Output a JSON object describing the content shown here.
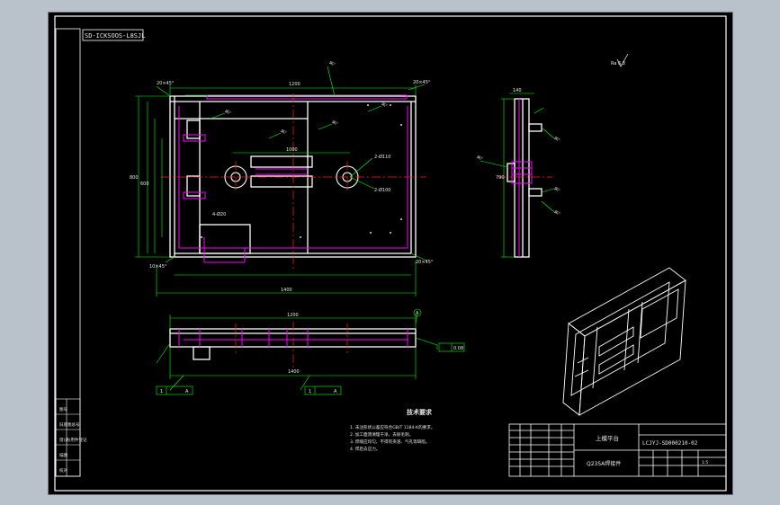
{
  "colors": {
    "background": "#000000",
    "border": "#ffffff",
    "outline": "#ffffff",
    "hidden": "#ff00ff",
    "dimension": "#00ff00",
    "center": "#ff2020",
    "text": "#e8e8e8"
  },
  "frame": {
    "drawing_code_box": "SD-ICKSOOS-L8SJL"
  },
  "views": {
    "front": {
      "dims": {
        "overall_width": "1400",
        "inner_width": "1200",
        "height_left": "800",
        "height_left2": "600",
        "center_mid": "1000",
        "hole_note_right": "2-Ø110",
        "hole_note_low": "2-Ø100",
        "corner_note_tl": "20×45°",
        "corner_note_tr": "20×45°",
        "corner_note_br": "20×45°",
        "corner_note_bl": "10×45°",
        "slot_note": "4-Ø20",
        "weld_1": "4▷",
        "weld_2": "4▷",
        "weld_3": "4▷",
        "weld_4": "4▷",
        "weld_5": "4▷"
      }
    },
    "bottom": {
      "dims": {
        "length": "1200",
        "overall": "1400",
        "datum": "A",
        "flatness_label": "0.08",
        "ref_left": "A",
        "ref_right": "A",
        "mark_left": "1",
        "mark_right": "1"
      }
    },
    "side": {
      "dims": {
        "height": "790",
        "top_width": "140",
        "weld_a": "4▷",
        "weld_b": "4▷",
        "weld_c": "4▷",
        "weld_d": "4▷"
      }
    }
  },
  "roughness_symbol": "Ra 6.3",
  "tech_requirements": {
    "title": "技术要求",
    "items": [
      "1. 未注形状公差应符合GB/T 1184-K的要求。",
      "2. 加工面须清理干净，去除毛刺。",
      "3. 焊缝应均匀，不得有夹渣、气孔等缺陷。",
      "4. 焊后去应力。"
    ]
  },
  "title_block": {
    "part_name": "上模平台",
    "drawing_number": "LCJYJ-SD000210-02",
    "material": "Q235A焊接件",
    "scale": "1:5",
    "left_labels": [
      "图号",
      "旧底图总号",
      "借(通)用件登记",
      "描图",
      "校对"
    ]
  }
}
